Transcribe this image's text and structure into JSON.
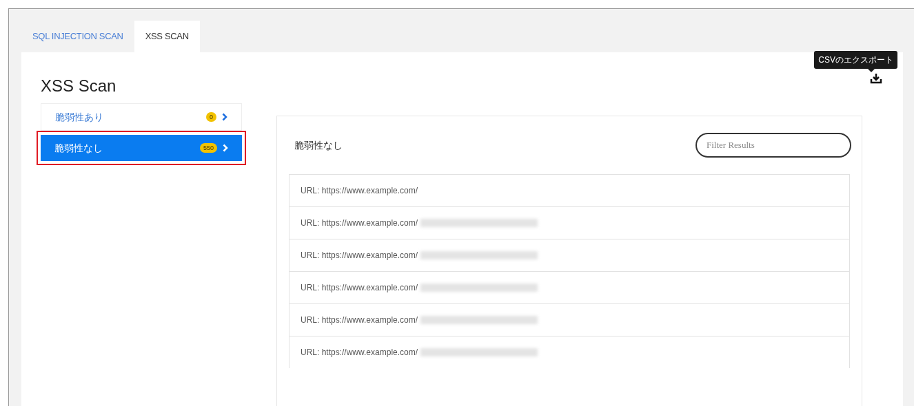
{
  "tabs": [
    {
      "label": "SQL INJECTION SCAN",
      "selected": false
    },
    {
      "label": "XSS SCAN",
      "selected": true
    }
  ],
  "title": "XSS Scan",
  "export": {
    "tooltip": "CSVのエクスポート"
  },
  "categories": [
    {
      "label": "脆弱性あり",
      "count": "0",
      "selected": false,
      "highlighted": false
    },
    {
      "label": "脆弱性なし",
      "count": "550",
      "selected": true,
      "highlighted": true
    }
  ],
  "results": {
    "heading": "脆弱性なし",
    "filter": {
      "placeholder": "Filter Results"
    },
    "rows": [
      {
        "url": "URL: https://www.example.com/",
        "redacted": false
      },
      {
        "url": "URL: https://www.example.com/",
        "redacted": true
      },
      {
        "url": "URL: https://www.example.com/",
        "redacted": true
      },
      {
        "url": "URL: https://www.example.com/",
        "redacted": true
      },
      {
        "url": "URL: https://www.example.com/",
        "redacted": true
      },
      {
        "url": "URL: https://www.example.com/",
        "redacted": true
      }
    ]
  }
}
